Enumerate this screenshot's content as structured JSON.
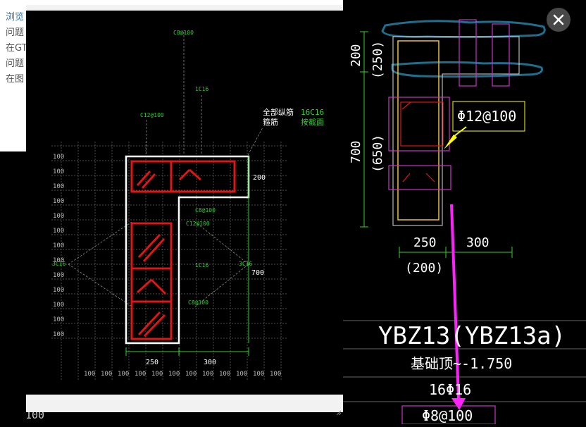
{
  "background_page": {
    "lines": [
      "浏览",
      "问题",
      "在GT",
      "问题",
      "在图"
    ],
    "bottom_label": "100"
  },
  "viewer": {
    "annotations": {
      "top_label": "C8@100",
      "label_1c16_top": "1C16",
      "label_c12": "C12@100",
      "legend_line1": "全部纵筋",
      "legend_line2": "箍筋",
      "legend_value1": "16C16",
      "legend_value2": "按截面",
      "c8_mid": "C8@100",
      "c12_mid": "C12@100",
      "label_1c16_mid": "1C16",
      "c8_low": "C8@100",
      "left_3c16": "3C16",
      "right_3c16": "3C16"
    },
    "dims": {
      "d200": "200",
      "d700": "700",
      "d250": "250",
      "d300": "300"
    },
    "grid_label": "100"
  },
  "right_drawing": {
    "dim_200": "200",
    "dim_250_paren": "(250)",
    "dim_700": "700",
    "dim_650_paren": "(650)",
    "dim_250": "250",
    "dim_300": "300",
    "dim_200_paren": "(200)",
    "callout": "Φ12@100",
    "title": "YBZ13(YBZ13a)",
    "base_range": "基础顶~-1.750",
    "longitudinal": "16Φ16",
    "stirrup": "Φ8@100"
  },
  "colors": {
    "cad_green": "#2fd12f",
    "rebar_red": "#e01515",
    "magenta": "#cc33cc",
    "callout_yellow": "#ffff00",
    "arrow_magenta": "#ff22ff"
  },
  "icons": {
    "close": "close-icon",
    "resize": "resize-grip-icon"
  }
}
